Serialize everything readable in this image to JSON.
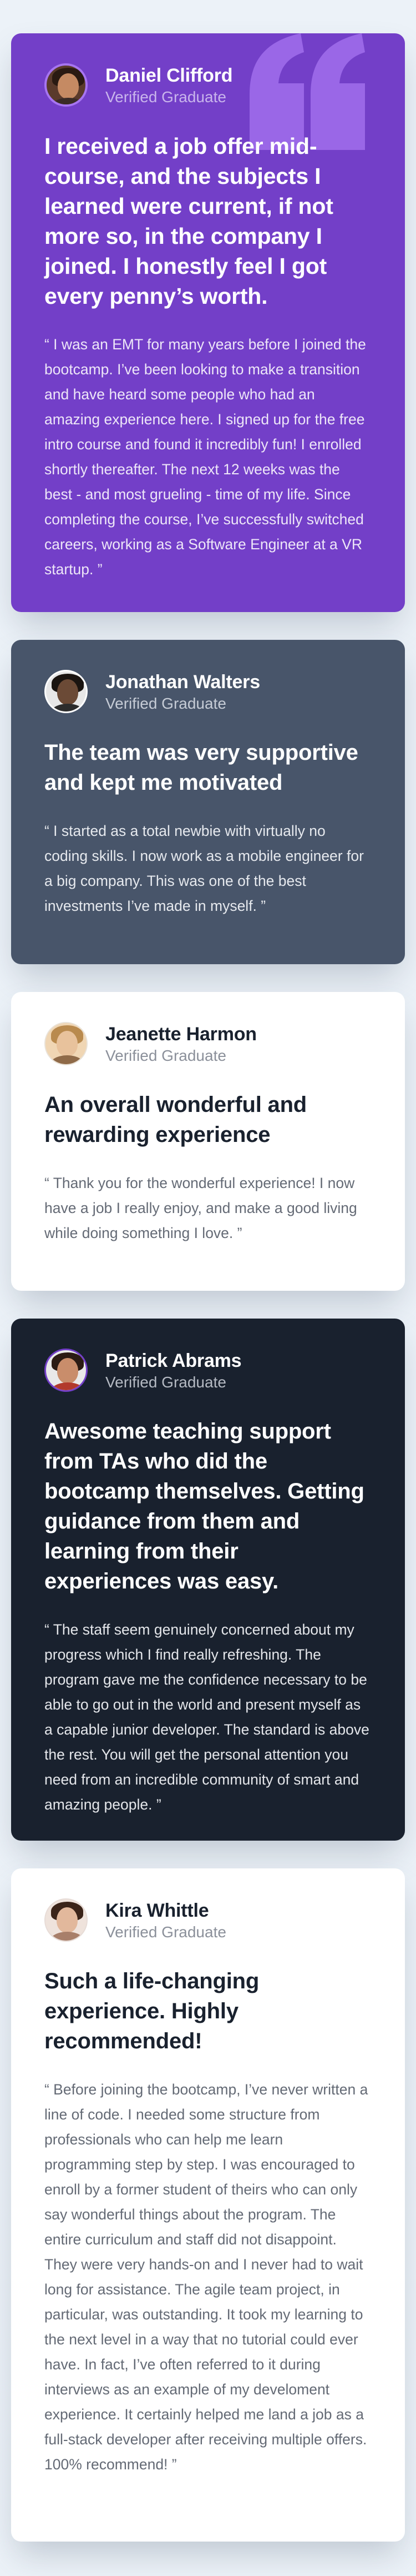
{
  "testimonials": [
    {
      "name": "Daniel Clifford",
      "role": "Verified Graduate",
      "headline": "I received a job offer mid-course, and the subjects I learned were current, if not more so, in the company I joined. I honestly feel I got every penny’s worth.",
      "quote": "“ I was an EMT for many years before I joined the bootcamp. I’ve been looking to make a transition and have heard some people who had an amazing experience here. I signed up for the free intro course and found it incredibly fun! I enrolled shortly thereafter. The next 12 weeks was the best - and most grueling - time of my life. Since completing the course, I’ve successfully switched careers, working as a Software Engineer at a VR startup. ”"
    },
    {
      "name": "Jonathan Walters",
      "role": "Verified Graduate",
      "headline": "The team was very supportive and kept me motivated",
      "quote": "“ I started as a total newbie with virtually no coding skills. I now work as a mobile engineer for a big company. This was one of the best investments I’ve made in myself. ”"
    },
    {
      "name": "Jeanette Harmon",
      "role": "Verified Graduate",
      "headline": "An overall wonderful and rewarding experience",
      "quote": "“ Thank you for the wonderful experience! I now have a job I really enjoy, and make a good living while doing something I love. ”"
    },
    {
      "name": "Patrick Abrams",
      "role": "Verified Graduate",
      "headline": "Awesome teaching support from TAs who did the bootcamp themselves. Getting guidance from them and learning from their experiences was easy.",
      "quote": "“ The staff seem genuinely concerned about my progress which I find really refreshing. The program gave me the confidence necessary to be able to go out in the world and present myself as a capable junior developer. The standard is above the rest. You will get the personal attention you need from an incredible community of smart and amazing people. ”"
    },
    {
      "name": "Kira Whittle",
      "role": "Verified Graduate",
      "headline": "Such a life-changing experience. Highly recommended!",
      "quote": "“ Before joining the bootcamp, I’ve never written a line of code. I needed some structure from professionals who can help me learn programming step by step. I was encouraged to enroll by a former student of theirs who can only say wonderful things about the program. The entire curriculum and staff did not disappoint. They were very hands-on and I never had to wait long for assistance. The agile team project, in particular, was outstanding. It took my learning to the next level in a way that no tutorial could ever have. In fact, I’ve often referred to it during interviews as an example of my develoment experience. It certainly helped me land a job as a full-stack developer after receiving multiple offers. 100% recommend! ”"
    }
  ],
  "icons": {
    "quote": "quotation-mark-icon",
    "avatar": "avatar"
  },
  "colors": {
    "background": "#ecf2f8",
    "moderate_violet": "#733fc8",
    "grayish_blue": "#48556a",
    "white": "#ffffff",
    "dark_blackish_blue": "#19212e",
    "light_violet": "#a775f1"
  }
}
